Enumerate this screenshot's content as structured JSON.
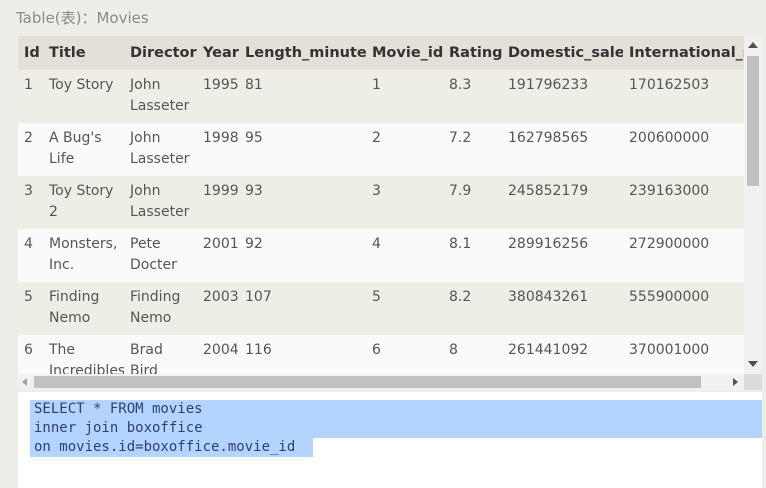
{
  "caption": "Table(表)：Movies",
  "table": {
    "columns": [
      "Id",
      "Title",
      "Director",
      "Year",
      "Length_minutes",
      "Movie_id",
      "Rating",
      "Domestic_sales",
      "International_sales"
    ],
    "rows": [
      {
        "id": "1",
        "title": "Toy Story",
        "director": "John Lasseter",
        "year": "1995",
        "length": "81",
        "movie_id": "1",
        "rating": "8.3",
        "domestic": "191796233",
        "international": "170162503"
      },
      {
        "id": "2",
        "title": "A Bug's Life",
        "director": "John Lasseter",
        "year": "1998",
        "length": "95",
        "movie_id": "2",
        "rating": "7.2",
        "domestic": "162798565",
        "international": "200600000"
      },
      {
        "id": "3",
        "title": "Toy Story 2",
        "director": "John Lasseter",
        "year": "1999",
        "length": "93",
        "movie_id": "3",
        "rating": "7.9",
        "domestic": "245852179",
        "international": "239163000"
      },
      {
        "id": "4",
        "title": "Monsters, Inc.",
        "director": "Pete Docter",
        "year": "2001",
        "length": "92",
        "movie_id": "4",
        "rating": "8.1",
        "domestic": "289916256",
        "international": "272900000"
      },
      {
        "id": "5",
        "title": "Finding Nemo",
        "director": "Finding Nemo",
        "year": "2003",
        "length": "107",
        "movie_id": "5",
        "rating": "8.2",
        "domestic": "380843261",
        "international": "555900000"
      },
      {
        "id": "6",
        "title": "The Incredibles",
        "director": "Brad Bird",
        "year": "2004",
        "length": "116",
        "movie_id": "6",
        "rating": "8",
        "domestic": "261441092",
        "international": "370001000"
      }
    ]
  },
  "editor": {
    "lines": [
      "SELECT * FROM movies",
      "inner join boxoffice",
      "on movies.id=boxoffice.movie_id"
    ]
  }
}
